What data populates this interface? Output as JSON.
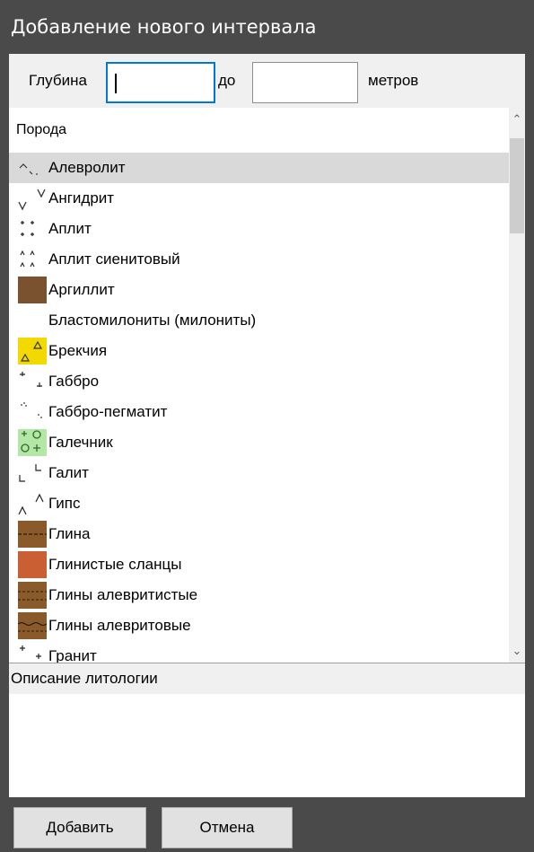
{
  "window": {
    "title": "Добавление нового интервала"
  },
  "depth": {
    "label_from": "Глубина",
    "label_to": "до",
    "label_units": "метров",
    "from_value": "",
    "to_value": ""
  },
  "rock_list": {
    "header": "Порода",
    "items": [
      {
        "label": "Алевролит",
        "icon": "siltstone-pattern-icon",
        "selected": true
      },
      {
        "label": "Ангидрит",
        "icon": "anhydrite-pattern-icon"
      },
      {
        "label": "Аплит",
        "icon": "aplite-pattern-icon"
      },
      {
        "label": "Аплит сиенитовый",
        "icon": "syenite-aplite-pattern-icon"
      },
      {
        "label": "Аргиллит",
        "icon": "argillite-swatch-icon"
      },
      {
        "label": "Бластомилониты (милониты)",
        "icon": ""
      },
      {
        "label": "Брекчия",
        "icon": "breccia-pattern-icon"
      },
      {
        "label": "Габбро",
        "icon": "gabbro-pattern-icon"
      },
      {
        "label": "Габбро-пегматит",
        "icon": "gabbro-pegmatite-pattern-icon"
      },
      {
        "label": "Галечник",
        "icon": "pebble-pattern-icon"
      },
      {
        "label": "Галит",
        "icon": "halite-pattern-icon"
      },
      {
        "label": "Гипс",
        "icon": "gypsum-pattern-icon"
      },
      {
        "label": "Глина",
        "icon": "clay-swatch-icon"
      },
      {
        "label": "Глинистые сланцы",
        "icon": "clay-shale-swatch-icon"
      },
      {
        "label": "Глины алевритистые",
        "icon": "silty-clay-swatch-icon"
      },
      {
        "label": "Глины алевритовые",
        "icon": "silt-clay-swatch-icon"
      },
      {
        "label": "Гранит",
        "icon": "granite-pattern-icon"
      }
    ]
  },
  "description": {
    "label": "Описание литологии",
    "value": ""
  },
  "buttons": {
    "add": "Добавить",
    "cancel": "Отмена"
  },
  "colors": {
    "title_bar": "#4a4a4a",
    "selection": "#d9d9d9",
    "focus": "#0078d7",
    "argillite": "#7a5230",
    "clay": "#8a5a2b",
    "clay_shale": "#c95f33",
    "silty_clay": "#8a5a2b",
    "breccia": "#f2d900",
    "pebble": "#b4e6a6"
  }
}
